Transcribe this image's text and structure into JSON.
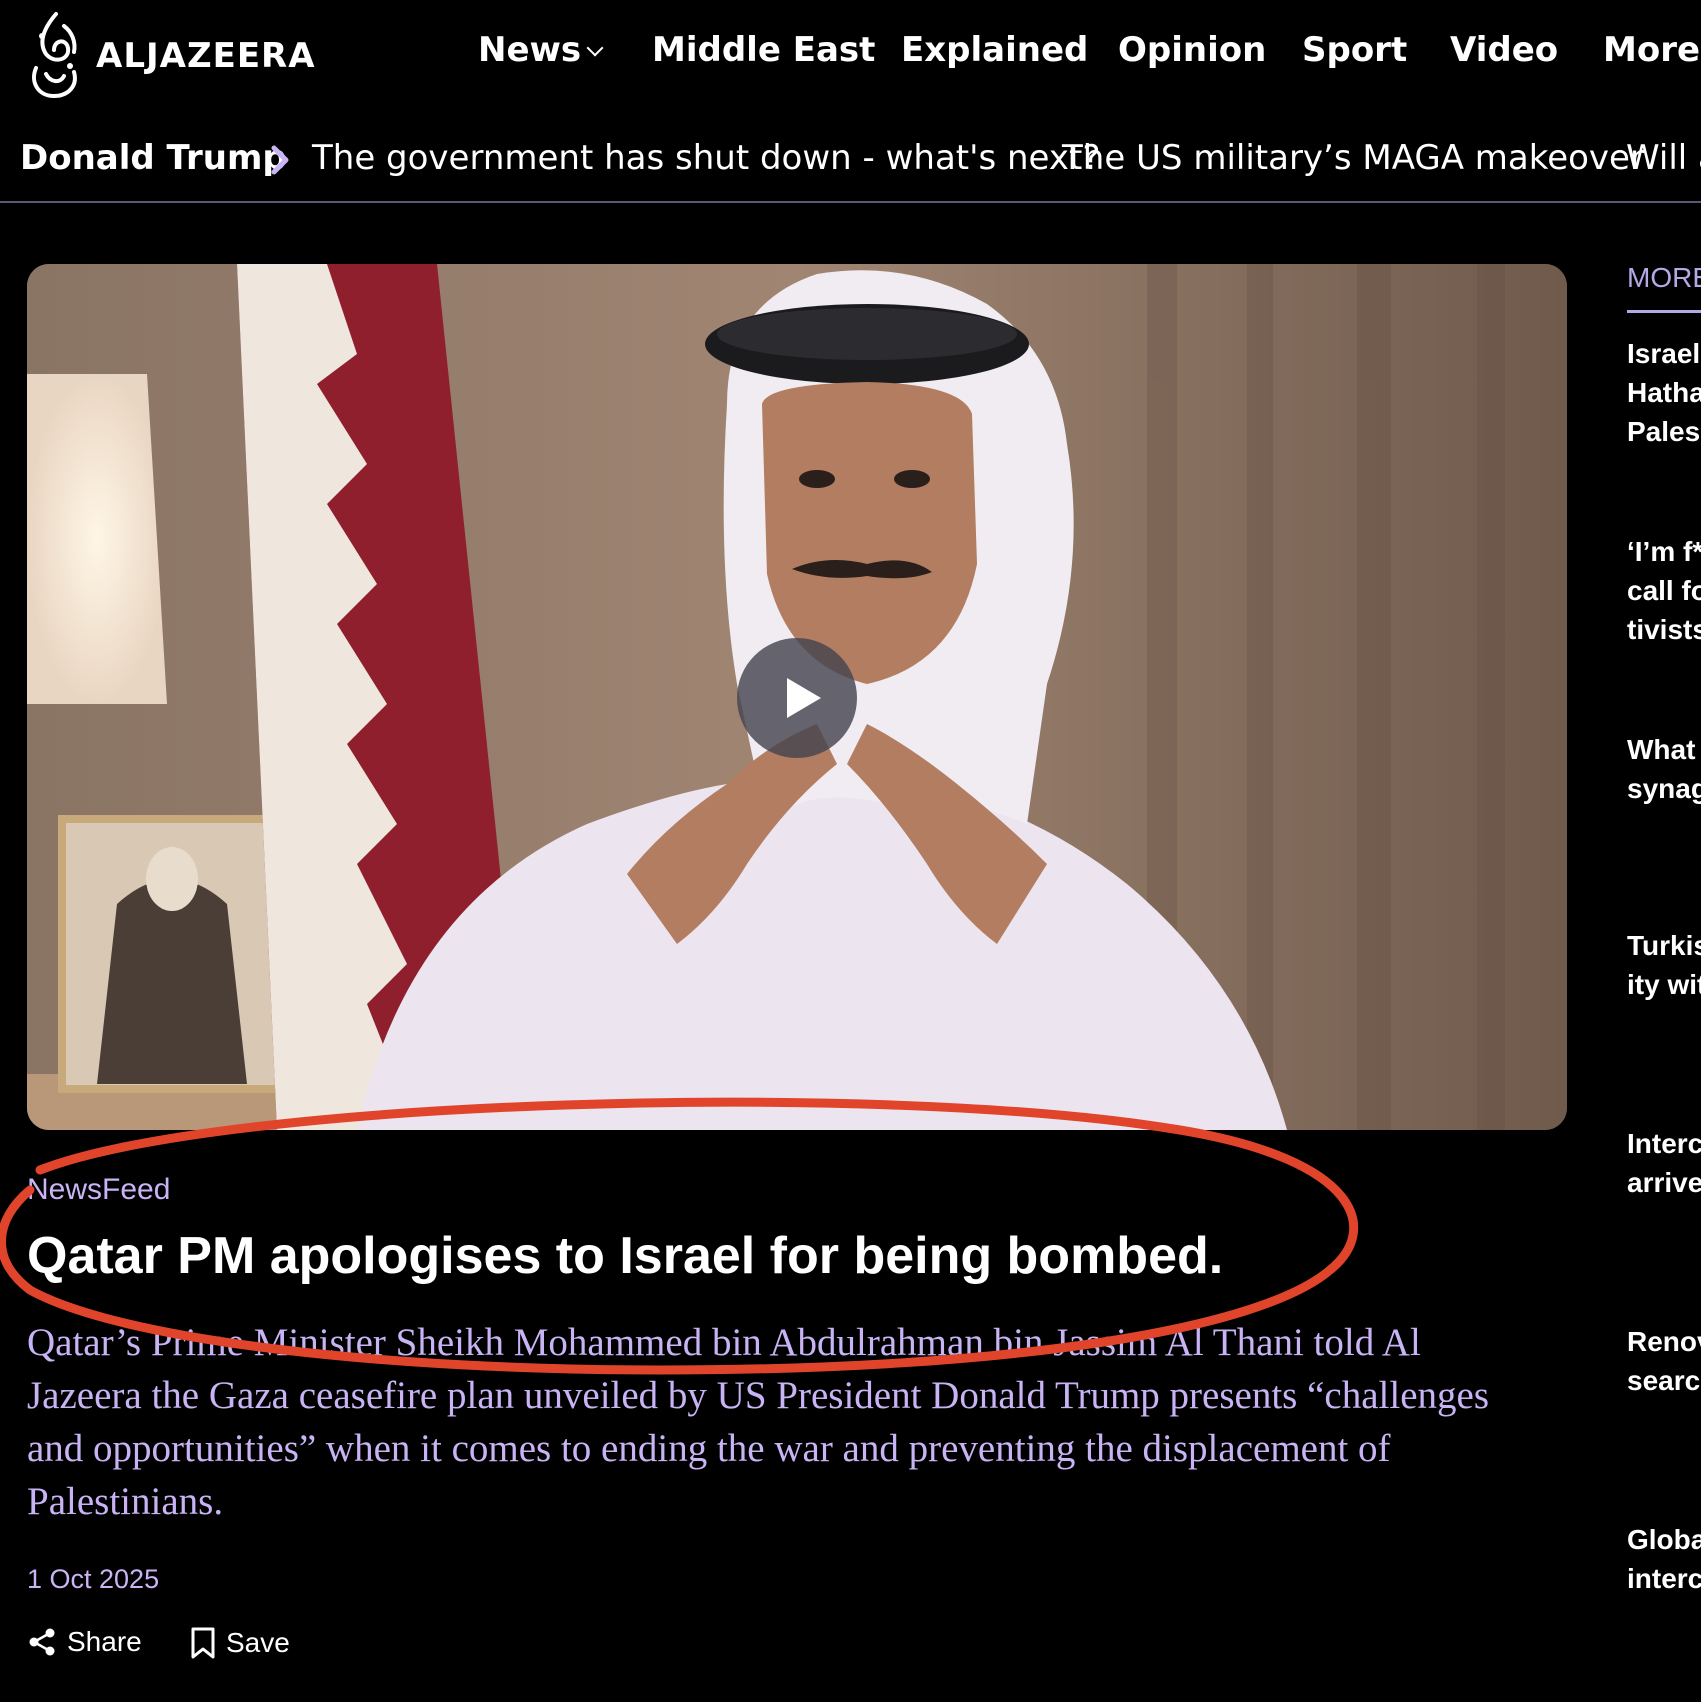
{
  "brand": {
    "name": "ALJAZEERA"
  },
  "nav": {
    "items": [
      "News",
      "Middle East",
      "Explained",
      "Opinion",
      "Sport",
      "Video",
      "More"
    ]
  },
  "trending": {
    "label": "Donald Trump",
    "links": [
      "The government has shut down - what's next?",
      "The US military’s MAGA makeover",
      "Will a"
    ]
  },
  "article": {
    "kicker": "NewsFeed",
    "headline": "Qatar PM apologises to Israel for being bombed.",
    "summary": "Qatar’s Prime Minister Sheikh Mohammed bin Abdulrahman bin Jassim Al Thani told Al Jazeera the Gaza ceasefire plan unveiled by US President Donald Trump presents “challenges and opportunities” when it comes to ending the war and preventing the displacement of Palestinians.",
    "date": "1 Oct 2025",
    "share_label": "Share",
    "save_label": "Save"
  },
  "rail": {
    "heading": "MORE",
    "items": [
      "Israel\nHatha\nPales",
      "‘I’m f*\ncall fo\ntivists",
      "What\nsynag",
      "Turkis\nity wit",
      "Interc\narrive",
      "Renov\nsearc",
      "Globa\ninterc"
    ]
  },
  "colors": {
    "background": "#000000",
    "accent_text": "#c8b4f4",
    "annotation": "#e0442a"
  },
  "icons": {
    "logo": "aljazeera-calligraphy-icon",
    "nav_more": "chevron-down-icon",
    "trending": "chevron-right-icon",
    "video": "play-icon",
    "share": "share-icon",
    "save": "bookmark-icon"
  }
}
